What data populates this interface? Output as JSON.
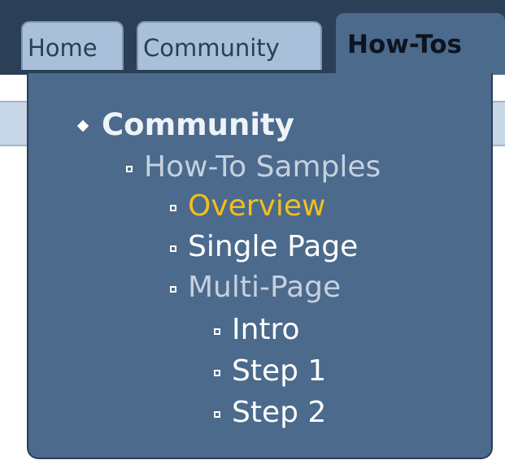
{
  "tabs": [
    {
      "label": "Home",
      "active": false
    },
    {
      "label": "Community",
      "active": false
    },
    {
      "label": "How-Tos",
      "active": true
    }
  ],
  "menu": {
    "root": {
      "label": "Community"
    },
    "section": {
      "label": "How-To Samples"
    },
    "items": [
      {
        "label": "Overview",
        "state": "current"
      },
      {
        "label": "Single Page",
        "state": "normal"
      },
      {
        "label": "Multi-Page",
        "state": "dim"
      }
    ],
    "subitems": [
      {
        "label": "Intro"
      },
      {
        "label": "Step 1"
      },
      {
        "label": "Step 2"
      }
    ]
  },
  "colors": {
    "header_bg": "#2b3f56",
    "menu_bg": "#4b6a8c",
    "tab_bg": "#a9c0da",
    "highlight": "#f3bf1b",
    "dim_text": "#c5d1de",
    "text": "#ffffff"
  }
}
